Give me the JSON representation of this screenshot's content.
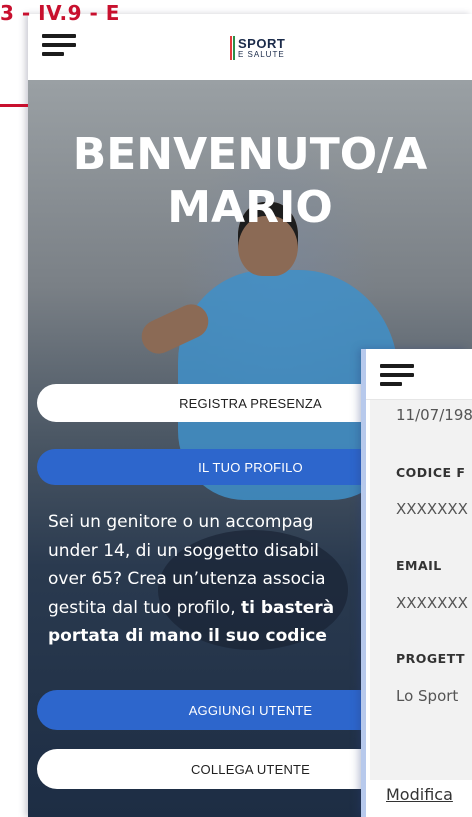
{
  "doc_code": "3 - IV.9 - E",
  "header": {
    "logo": {
      "line1": "SPORT",
      "line2": "E SALUTE"
    },
    "menu_icon": "hamburger-icon"
  },
  "hero": {
    "welcome_line1": "BENVENUTO/A",
    "welcome_line2": "MARIO"
  },
  "buttons": {
    "register": "REGISTRA PRESENZA",
    "profile": "IL TUO PROFILO",
    "add_user": "AGGIUNGI UTENTE",
    "link_user": "COLLEGA UTENTE"
  },
  "info": {
    "line1": "Sei un genitore o un accompag",
    "line2": "under 14, di un soggetto disabil",
    "line3": "over 65? Crea un’utenza associa",
    "line4_plain": "gestita dal tuo profilo, ",
    "line4_bold": "ti basterà",
    "line5_bold": "portata di mano il suo codice"
  },
  "profile_panel": {
    "birthdate": "11/07/198",
    "codice_label": "CODICE F",
    "codice_value": "XXXXXXX",
    "email_label": "EMAIL",
    "email_value": "XXXXXXX",
    "progetto_label": "PROGETT",
    "progetto_value": "Lo Sport",
    "edit_link": "Modifica"
  },
  "colors": {
    "accent_blue": "#2d66cc",
    "doc_red": "#c8102e",
    "logo_navy": "#1b2b4a"
  }
}
